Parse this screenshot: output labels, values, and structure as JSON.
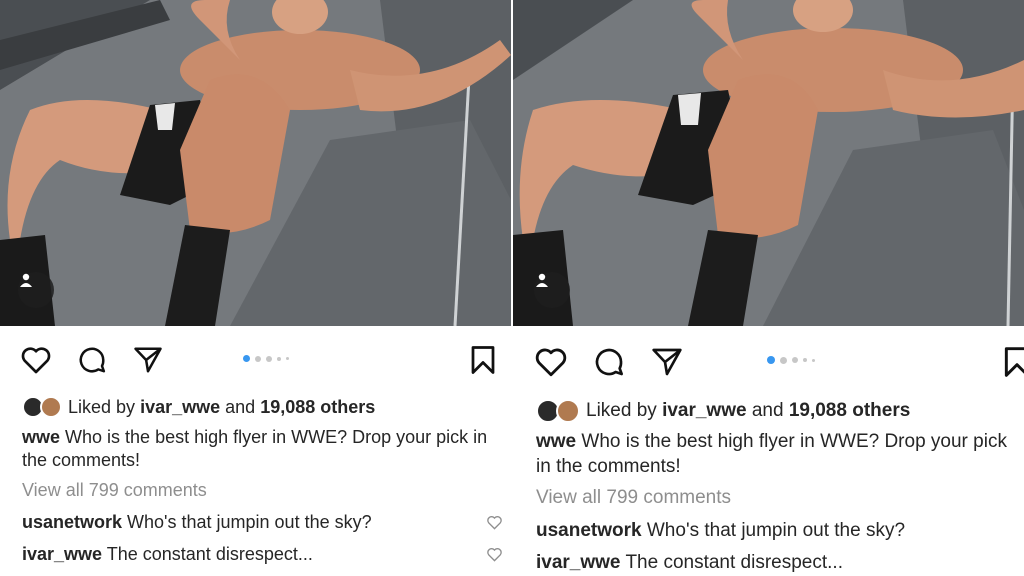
{
  "post": {
    "liked_by_prefix": "Liked by",
    "liked_by_user": "ivar_wwe",
    "liked_by_mid": "and",
    "liked_by_count": "19,088 others",
    "caption_user": "wwe",
    "caption_text": "Who is the best high flyer in WWE? Drop your pick in the comments!",
    "view_all": "View all 799 comments",
    "comments": [
      {
        "user": "usanetwork",
        "text": "Who's that jumpin out the sky?"
      },
      {
        "user": "ivar_wwe",
        "text": "The constant disrespect..."
      }
    ],
    "carousel": {
      "count": 5,
      "active_index": 0
    }
  },
  "icons": [
    "heart-icon",
    "comment-icon",
    "share-icon",
    "bookmark-icon",
    "user-tag-icon",
    "small-heart-icon"
  ],
  "colors": {
    "accent_dot": "#3897f0",
    "muted_text": "#8e8e8e"
  }
}
